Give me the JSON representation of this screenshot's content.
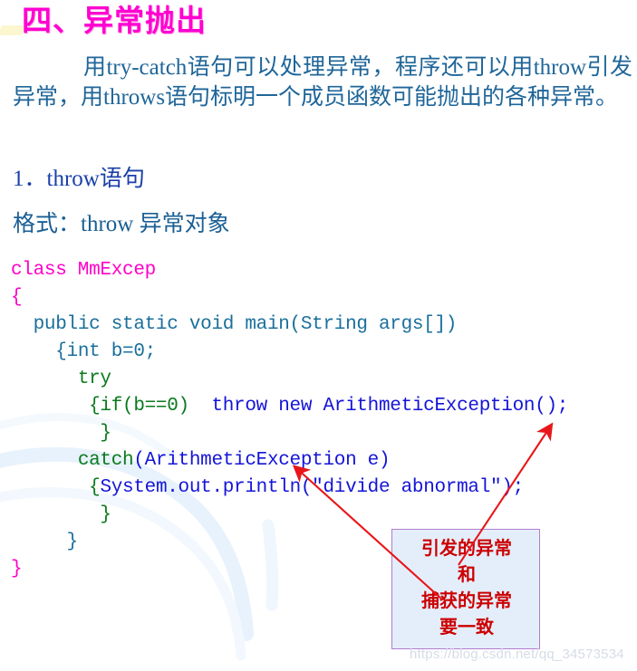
{
  "slide": {
    "background_color": "#ffffff",
    "title": "四、异常抛出",
    "title_color": "#ff00d0"
  },
  "intro": {
    "text": "用try-catch语句可以处理异常，程序还可以用throw引发异常，用throws语句标明一个成员函数可能抛出的各种异常。",
    "color": "#1f6699"
  },
  "headings": {
    "item1": "1．throw语句",
    "item2": "格式：throw  异常对象",
    "color": "#1a3faa"
  },
  "code": {
    "colors": {
      "magenta": "#ff00c8",
      "teal": "#1a6f9c",
      "green": "#0a7a1e",
      "blue": "#1414d8"
    },
    "lines": [
      {
        "id": "line-1",
        "indent": "",
        "tokens": [
          {
            "t": "class MmExcep",
            "c": "c-mag"
          }
        ]
      },
      {
        "id": "line-2",
        "indent": "",
        "tokens": [
          {
            "t": "{",
            "c": "c-mag"
          }
        ]
      },
      {
        "id": "line-3",
        "indent": "  ",
        "tokens": [
          {
            "t": "public static void main(String args[])",
            "c": "c-teal"
          }
        ]
      },
      {
        "id": "line-4",
        "indent": "    ",
        "tokens": [
          {
            "t": "{int b=0;",
            "c": "c-teal"
          }
        ]
      },
      {
        "id": "line-5",
        "indent": "      ",
        "tokens": [
          {
            "t": "try",
            "c": "c-green"
          }
        ]
      },
      {
        "id": "line-6",
        "indent": "       ",
        "tokens": [
          {
            "t": "{if(b==0)",
            "c": "c-green"
          },
          {
            "t": "  throw new ArithmeticException();",
            "c": "c-blue"
          }
        ]
      },
      {
        "id": "line-7",
        "indent": "        ",
        "tokens": [
          {
            "t": "}",
            "c": "c-green"
          }
        ]
      },
      {
        "id": "line-8",
        "indent": "      ",
        "tokens": [
          {
            "t": "catch",
            "c": "c-green"
          },
          {
            "t": "(ArithmeticException e)",
            "c": "c-blue"
          }
        ]
      },
      {
        "id": "line-9",
        "indent": "       ",
        "tokens": [
          {
            "t": "{",
            "c": "c-green"
          },
          {
            "t": "System.out.println(\"divide abnormal\");",
            "c": "c-blue"
          }
        ]
      },
      {
        "id": "line-10",
        "indent": "        ",
        "tokens": [
          {
            "t": "}",
            "c": "c-green"
          }
        ]
      },
      {
        "id": "line-11",
        "indent": "     ",
        "tokens": [
          {
            "t": "}",
            "c": "c-teal"
          }
        ]
      },
      {
        "id": "line-12",
        "indent": "",
        "tokens": [
          {
            "t": "}",
            "c": "c-mag"
          }
        ]
      }
    ]
  },
  "callout": {
    "lines": [
      "引发的异常",
      "和",
      "捕获的异常",
      "要一致"
    ],
    "text_color": "#cc0000",
    "fill_color": "#e4eefb",
    "border_color": "#b07dcf"
  },
  "annotations": {
    "arrow_color": "#e8161a",
    "arrow1_label": "arrow-to-thrown-exception",
    "arrow2_label": "arrow-to-caught-exception"
  },
  "watermark": {
    "text": "https://blog.csdn.net/qq_34573534",
    "color": "#d6dce6"
  }
}
